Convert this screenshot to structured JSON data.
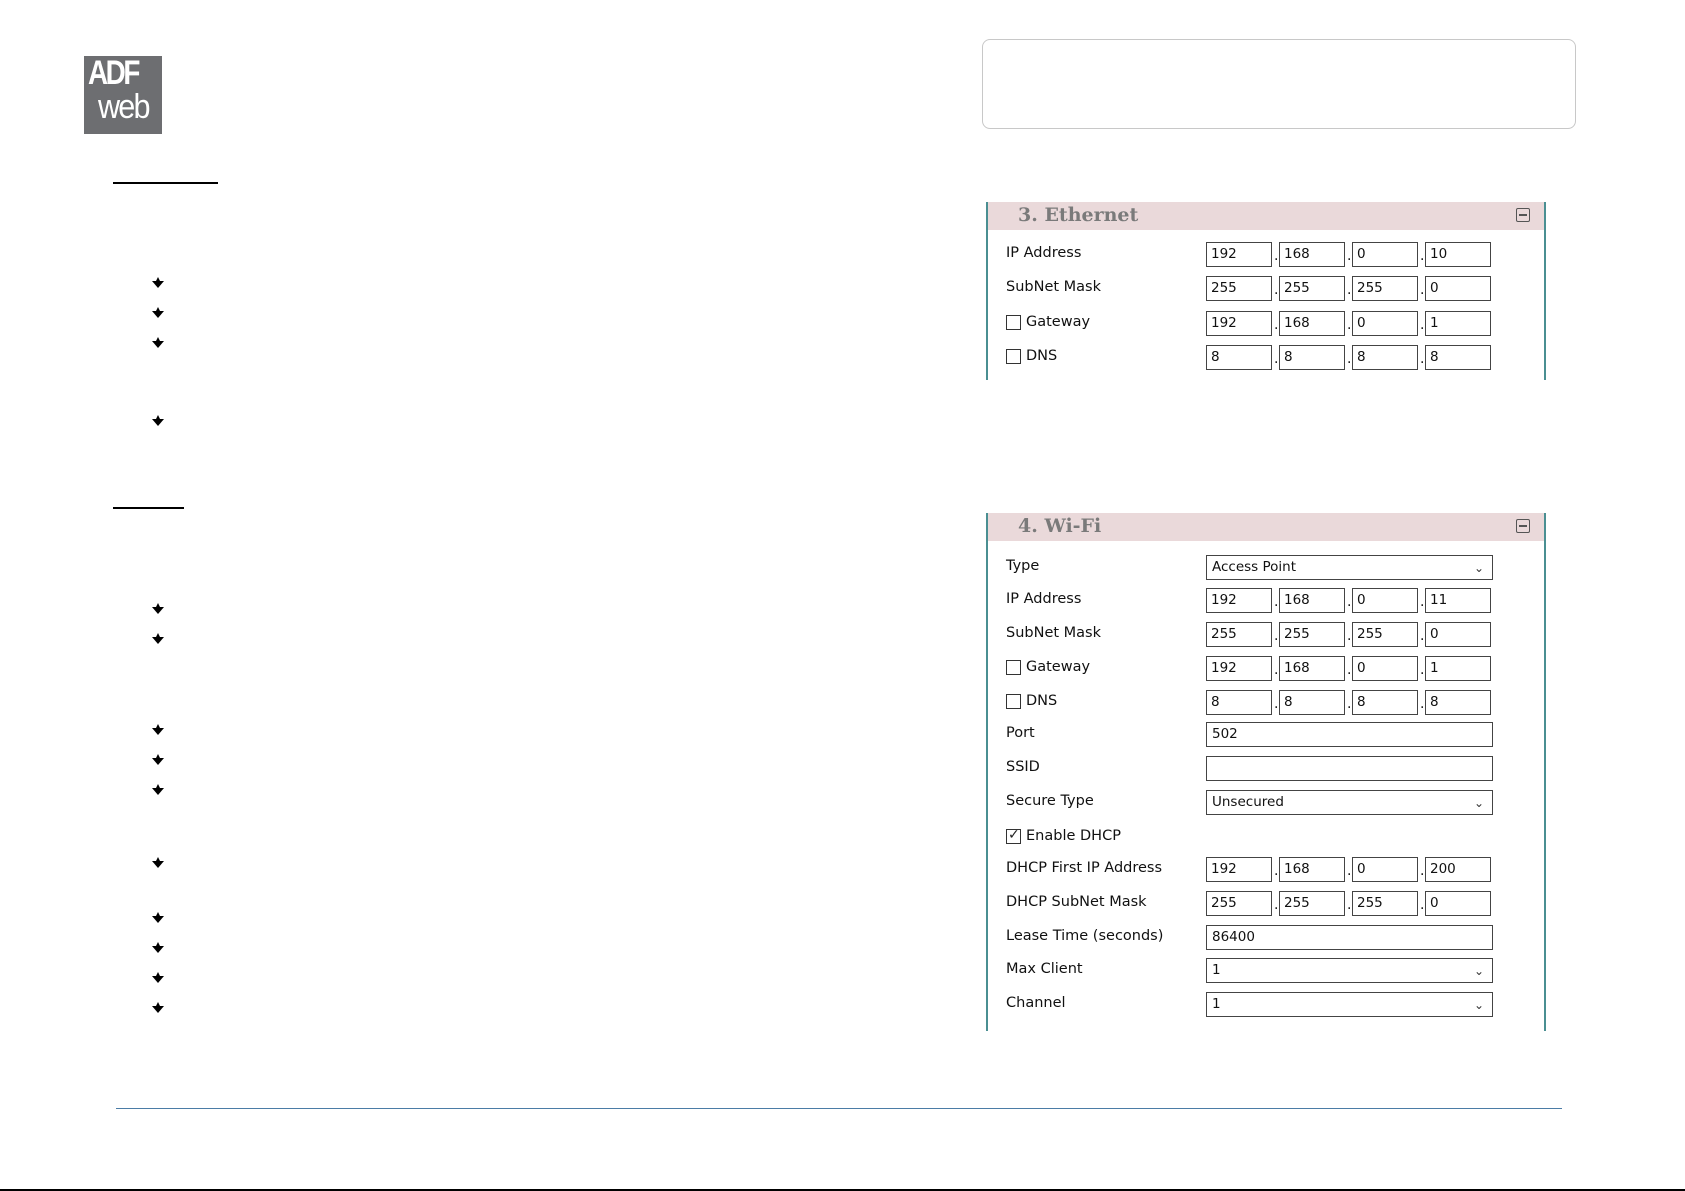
{
  "logo": {
    "line1": "ADF",
    "line2": "web"
  },
  "ethernet_panel": {
    "title": "3. Ethernet",
    "rows": [
      {
        "label": "IP Address",
        "octets": [
          "192",
          "168",
          "0",
          "10"
        ]
      },
      {
        "label": "SubNet Mask",
        "octets": [
          "255",
          "255",
          "255",
          "0"
        ]
      },
      {
        "label": "Gateway",
        "checked": false,
        "octets": [
          "192",
          "168",
          "0",
          "1"
        ]
      },
      {
        "label": "DNS",
        "checked": false,
        "octets": [
          "8",
          "8",
          "8",
          "8"
        ]
      }
    ]
  },
  "wifi_panel": {
    "title": "4. Wi-Fi",
    "type": {
      "label": "Type",
      "value": "Access Point"
    },
    "ip": {
      "label": "IP Address",
      "octets": [
        "192",
        "168",
        "0",
        "11"
      ]
    },
    "mask": {
      "label": "SubNet Mask",
      "octets": [
        "255",
        "255",
        "255",
        "0"
      ]
    },
    "gateway": {
      "label": "Gateway",
      "checked": false,
      "octets": [
        "192",
        "168",
        "0",
        "1"
      ]
    },
    "dns": {
      "label": "DNS",
      "checked": false,
      "octets": [
        "8",
        "8",
        "8",
        "8"
      ]
    },
    "port": {
      "label": "Port",
      "value": "502"
    },
    "ssid": {
      "label": "SSID",
      "value": ""
    },
    "secure": {
      "label": "Secure Type",
      "value": "Unsecured"
    },
    "dhcp": {
      "label": "Enable DHCP",
      "checked": true
    },
    "dhcp_first": {
      "label": "DHCP First IP Address",
      "octets": [
        "192",
        "168",
        "0",
        "200"
      ]
    },
    "dhcp_mask": {
      "label": "DHCP SubNet Mask",
      "octets": [
        "255",
        "255",
        "255",
        "0"
      ]
    },
    "lease": {
      "label": "Lease Time (seconds)",
      "value": "86400"
    },
    "max_client": {
      "label": "Max Client",
      "value": "1"
    },
    "channel": {
      "label": "Channel",
      "value": "1"
    }
  },
  "colors": {
    "panel_header": "#ead9da",
    "panel_border": "#4a8f92",
    "footer_rule": "#4b7ca6",
    "logo_bg": "#6d6e71"
  }
}
